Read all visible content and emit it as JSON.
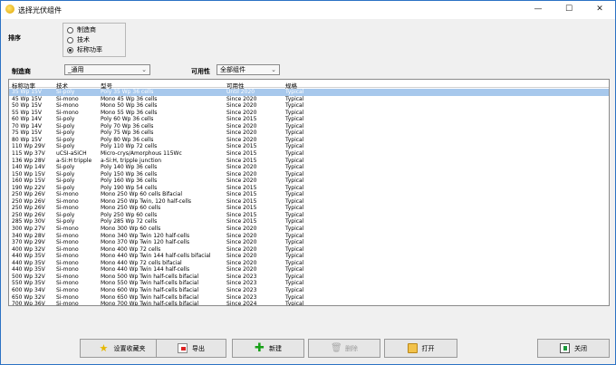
{
  "window": {
    "title": "选择光伏组件"
  },
  "sort": {
    "label": "排序",
    "options": [
      {
        "label": "制造商",
        "checked": false
      },
      {
        "label": "技术",
        "checked": false
      },
      {
        "label": "标称功率",
        "checked": true
      }
    ]
  },
  "filters": {
    "manufacturer_label": "制造商",
    "manufacturer_value": "_通用",
    "availability_label": "可用性",
    "availability_value": "全部组件"
  },
  "table": {
    "headers": [
      "标称功率",
      "技术",
      "型号",
      "可用性",
      "规格"
    ],
    "rows": [
      [
        "35 Wp 15V",
        "Si-poly",
        "Poly 35 Wp 36 cells",
        "Until 2020",
        "Typical"
      ],
      [
        "45 Wp 15V",
        "Si-mono",
        "Mono 45 Wp 36 cells",
        "Since 2020",
        "Typical"
      ],
      [
        "50 Wp 15V",
        "Si-mono",
        "Mono 50 Wp 36 cells",
        "Since 2020",
        "Typical"
      ],
      [
        "55 Wp 15V",
        "Si-mono",
        "Mono 55 Wp 36 cells",
        "Since 2020",
        "Typical"
      ],
      [
        "60 Wp 14V",
        "Si-poly",
        "Poly 60 Wp  36 cells",
        "Since 2015",
        "Typical"
      ],
      [
        "70 Wp 14V",
        "Si-poly",
        "Poly 70 Wp 36 cells",
        "Since 2020",
        "Typical"
      ],
      [
        "75 Wp 15V",
        "Si-poly",
        "Poly 75 Wp 36 cells",
        "Since 2020",
        "Typical"
      ],
      [
        "80 Wp 15V",
        "Si-poly",
        "Poly 80 Wp 36 cells",
        "Since 2020",
        "Typical"
      ],
      [
        "110 Wp 29V",
        "Si-poly",
        "Poly 110 Wp  72 cells",
        "Since 2015",
        "Typical"
      ],
      [
        "115 Wp 37V",
        "uCSI-aSiCH",
        "Micro-crys/Amorphous 115Wc",
        "Since 2015",
        "Typical"
      ],
      [
        "136 Wp 28V",
        "a-Si:H tripple",
        "a-Si:H, tripple junction",
        "Since 2015",
        "Typical"
      ],
      [
        "140 Wp 14V",
        "Si-poly",
        "Poly 140 Wp 36 cells",
        "Since 2020",
        "Typical"
      ],
      [
        "150 Wp 15V",
        "Si-poly",
        "Poly 150 Wp 36 cells",
        "Since 2020",
        "Typical"
      ],
      [
        "160 Wp 15V",
        "Si-poly",
        "Poly 160 Wp 36 cells",
        "Since 2020",
        "Typical"
      ],
      [
        "190 Wp 22V",
        "Si-poly",
        "Poly 190 Wp  54 cells",
        "Since 2015",
        "Typical"
      ],
      [
        "250 Wp 26V",
        "Si-mono",
        "Mono 250 Wp  60 cells Bifacial",
        "Since 2015",
        "Typical"
      ],
      [
        "250 Wp 26V",
        "Si-mono",
        "Mono 250 Wp  Twin, 120 half-cells",
        "Since 2015",
        "Typical"
      ],
      [
        "250 Wp 26V",
        "Si-mono",
        "Mono 250 Wp  60 cells",
        "Since 2015",
        "Typical"
      ],
      [
        "250 Wp 26V",
        "Si-poly",
        "Poly 250 Wp  60 cells",
        "Since 2015",
        "Typical"
      ],
      [
        "285 Wp 30V",
        "Si-poly",
        "Poly 285 Wp  72 cells",
        "Since 2015",
        "Typical"
      ],
      [
        "300 Wp 27V",
        "Si-mono",
        "Mono 300 Wp 60 cells",
        "Since 2020",
        "Typical"
      ],
      [
        "340 Wp 28V",
        "Si-mono",
        "Mono 340 Wp Twin 120 half-cells",
        "Since 2020",
        "Typical"
      ],
      [
        "370 Wp 29V",
        "Si-mono",
        "Mono 370 Wp Twin 120 half-cells",
        "Since 2020",
        "Typical"
      ],
      [
        "400 Wp 32V",
        "Si-mono",
        "Mono 400 Wp 72 cells",
        "Since 2020",
        "Typical"
      ],
      [
        "440 Wp 35V",
        "Si-mono",
        "Mono 440 Wp Twin 144 half-cells bifacial",
        "Since 2020",
        "Typical"
      ],
      [
        "440 Wp 35V",
        "Si-mono",
        "Mono 440 Wp 72 cells bifacial",
        "Since 2020",
        "Typical"
      ],
      [
        "440 Wp 35V",
        "Si-mono",
        "Mono 440 Wp Twin 144 half-cells",
        "Since 2020",
        "Typical"
      ],
      [
        "500 Wp 32V",
        "Si-mono",
        "Mono 500 Wp Twin half-cells bifacial",
        "Since 2023",
        "Typical"
      ],
      [
        "550 Wp 35V",
        "Si-mono",
        "Mono 550 Wp Twin half-cells bifacial",
        "Since 2023",
        "Typical"
      ],
      [
        "600 Wp 34V",
        "Si-mono",
        "Mono 600 Wp Twin half-cells bifacial",
        "Since 2023",
        "Typical"
      ],
      [
        "650 Wp 32V",
        "Si-mono",
        "Mono 650 Wp Twin half-cells bifacial",
        "Since 2023",
        "Typical"
      ],
      [
        "700 Wp 36V",
        "Si-mono",
        "Mono 700 Wp Twin half-cells bifacial",
        "Since 2024",
        "Typical"
      ]
    ],
    "selected_row": 0
  },
  "buttons": {
    "favorites": "设置收藏夹",
    "export": "导出",
    "new": "新建",
    "delete": "删除",
    "open": "打开",
    "close": "关闭"
  },
  "icons": {
    "favorites": "star-icon",
    "export": "export-icon",
    "new": "plus-icon",
    "delete": "trash-icon",
    "open": "folder-icon",
    "close": "exit-icon"
  }
}
